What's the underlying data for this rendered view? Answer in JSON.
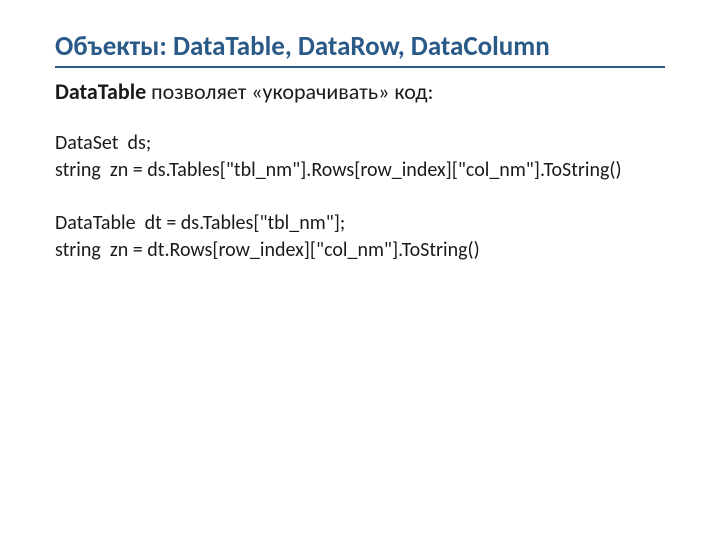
{
  "slide": {
    "title": "Объекты: DataTable, DataRow, DataColumn",
    "intro_bold": "DataTable",
    "intro_rest": " позволяет «укорачивать» код:",
    "code": {
      "line1": "DataSet  ds;",
      "line2": "string  zn = ds.Tables[\"tbl_nm\"].Rows[row_index][\"col_nm\"].ToString()",
      "line3": "DataTable  dt = ds.Tables[\"tbl_nm\"];",
      "line4": "string  zn = dt.Rows[row_index][\"col_nm\"].ToString()"
    }
  }
}
